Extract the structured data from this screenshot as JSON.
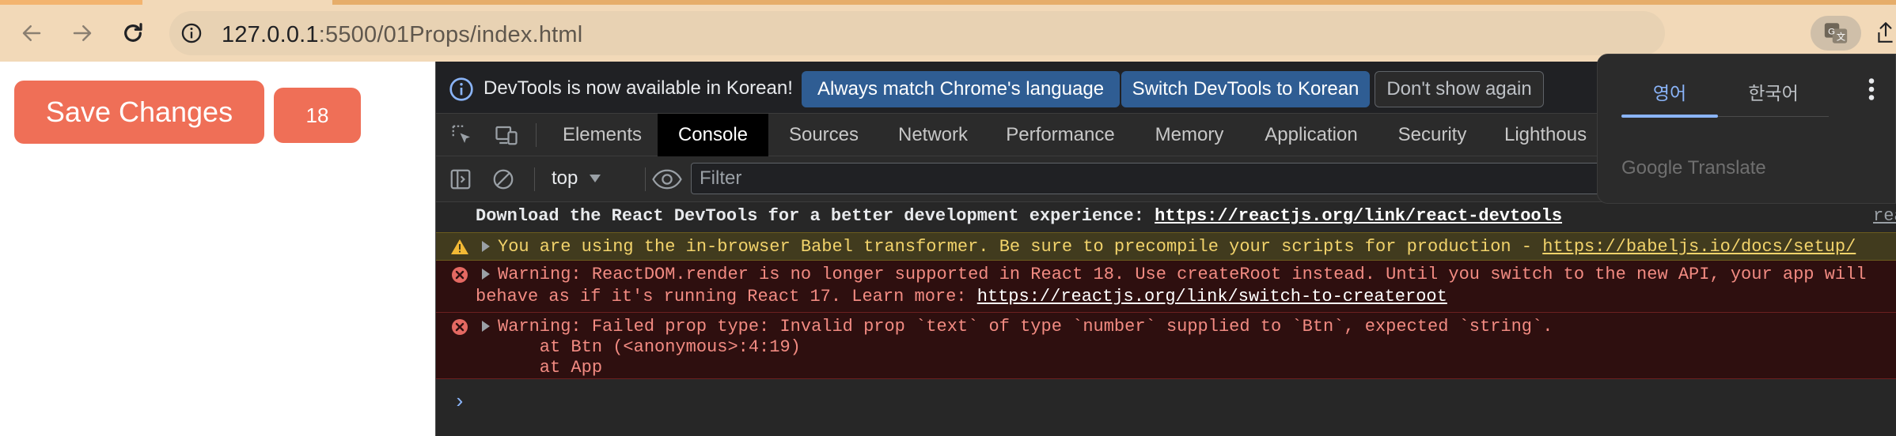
{
  "browser": {
    "url_host": "127.0.0.1",
    "url_rest": ":5500/01Props/index.html"
  },
  "page": {
    "save_button": "Save Changes",
    "count_button": "18"
  },
  "devtools": {
    "infobar": {
      "message": "DevTools is now available in Korean!",
      "match_button": "Always match Chrome's language",
      "switch_button": "Switch DevTools to Korean",
      "dont_show_button": "Don't show again"
    },
    "tabs": [
      "Elements",
      "Console",
      "Sources",
      "Network",
      "Performance",
      "Memory",
      "Application",
      "Security",
      "Lighthous"
    ],
    "active_tab": "Console",
    "toolbar": {
      "context": "top",
      "filter_placeholder": "Filter"
    },
    "console": {
      "info": {
        "text": "Download the React DevTools for a better development experience: ",
        "link": "https://reactjs.org/link/react-devtools",
        "source": "rea"
      },
      "warning": {
        "text": "You are using the in-browser Babel transformer. Be sure to precompile your scripts for production - ",
        "link": "https://babeljs.io/docs/setup/"
      },
      "error1": {
        "line1": "Warning: ReactDOM.render is no longer supported in React 18. Use createRoot instead. Until you switch to the new API, your app will",
        "line2": "behave as if it's running React 17. Learn more: ",
        "link": "https://reactjs.org/link/switch-to-createroot"
      },
      "error2": {
        "line1": "Warning: Failed prop type: Invalid prop `text` of type `number` supplied to `Btn`, expected `string`.",
        "line2": "    at Btn (<anonymous>:4:19)",
        "line3": "    at App"
      },
      "prompt": "›"
    }
  },
  "translate_popup": {
    "tab_source": "영어",
    "tab_target": "한국어",
    "brand": "Google Translate"
  },
  "colors": {
    "chrome_bg": "#f2d9b8",
    "button_tomato": "#ef6f57",
    "devtools_bg": "#272727",
    "warning_text": "#f2d36b",
    "error_text": "#f28b82",
    "infobar_button": "#2f5d93"
  },
  "icons": [
    "back-arrow-icon",
    "forward-arrow-icon",
    "reload-icon",
    "site-info-icon",
    "translate-icon",
    "share-icon",
    "info-circle-icon",
    "inspect-element-icon",
    "device-toolbar-icon",
    "sidebar-toggle-icon",
    "clear-console-icon",
    "dropdown-caret-icon",
    "eye-icon",
    "warning-icon",
    "error-icon",
    "more-vert-icon"
  ]
}
